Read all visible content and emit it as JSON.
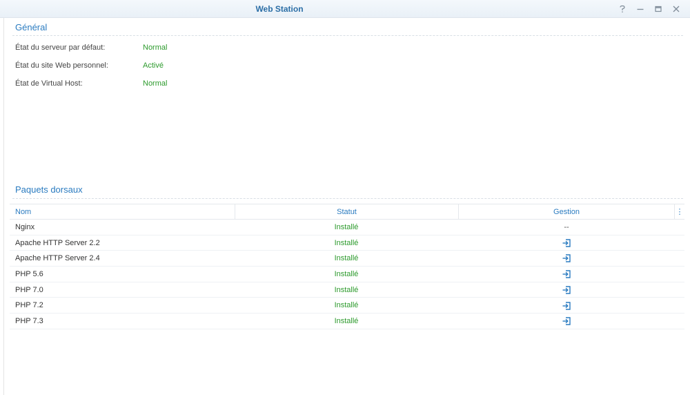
{
  "window": {
    "title": "Web Station"
  },
  "general": {
    "title": "Général",
    "rows": [
      {
        "label": "État du serveur par défaut:",
        "value": "Normal"
      },
      {
        "label": "État du site Web personnel:",
        "value": "Activé"
      },
      {
        "label": "État de Virtual Host:",
        "value": "Normal"
      }
    ]
  },
  "packages": {
    "title": "Paquets dorsaux",
    "columns": {
      "name": "Nom",
      "status": "Statut",
      "manage": "Gestion",
      "more": "⋮"
    },
    "rows": [
      {
        "name": "Nginx",
        "status": "Installé",
        "manage": "--"
      },
      {
        "name": "Apache HTTP Server 2.2",
        "status": "Installé",
        "manage": ""
      },
      {
        "name": "Apache HTTP Server 2.4",
        "status": "Installé",
        "manage": ""
      },
      {
        "name": "PHP 5.6",
        "status": "Installé",
        "manage": ""
      },
      {
        "name": "PHP 7.0",
        "status": "Installé",
        "manage": ""
      },
      {
        "name": "PHP 7.2",
        "status": "Installé",
        "manage": ""
      },
      {
        "name": "PHP 7.3",
        "status": "Installé",
        "manage": ""
      }
    ]
  },
  "colors": {
    "accent": "#2a7bc0",
    "ok": "#2c9a2c"
  }
}
